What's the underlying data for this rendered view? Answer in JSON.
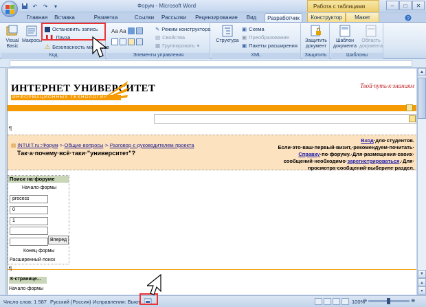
{
  "window": {
    "title": "Форум - Microsoft Word",
    "context_group": "Работа с таблицами"
  },
  "tabs": [
    {
      "label": "Главная"
    },
    {
      "label": "Вставка"
    },
    {
      "label": "Разметка страницы"
    },
    {
      "label": "Ссылки"
    },
    {
      "label": "Рассылки"
    },
    {
      "label": "Рецензирование"
    },
    {
      "label": "Вид"
    },
    {
      "label": "Разработчик"
    },
    {
      "label": "Конструктор"
    },
    {
      "label": "Макет"
    }
  ],
  "ribbon": {
    "code": {
      "label": "Код",
      "visual_basic": "Visual Basic",
      "macros": "Макросы",
      "stop_recording": "Остановить запись",
      "pause": "Пауза",
      "macro_security": "Безопасность макросов"
    },
    "controls": {
      "label": "Элементы управления",
      "design_mode": "Режим конструктора",
      "properties": "Свойства",
      "group": "Группировать"
    },
    "xml": {
      "label": "XML",
      "structure": "Структура",
      "schema": "Схема",
      "transform": "Преобразование",
      "expansion_packs": "Пакеты расширения"
    },
    "protect": {
      "label": "Защитить",
      "protect_document": "Защитить документ"
    },
    "templates": {
      "label": "Шаблоны",
      "document_template": "Шаблон документа",
      "document_panel": "Область документа"
    }
  },
  "document": {
    "logo_big": "ИНТЕРНЕТ УНИВЕРСИТЕТ",
    "logo_small": "ИНФОРМАЦИОННЫХ ТЕХНОЛОГИЙ",
    "slogan": "Твой·путь·к·знаниям",
    "pilcrow": "¶",
    "breadcrumb": {
      "site": "INTUIT.ru::Форум",
      "sep": "·>·",
      "general": "Общие·вопросы",
      "topic": "Разговор·с·руководителем·проекта"
    },
    "topic_title": "Так·а·почему·всё·таки·\"университет\"?",
    "right_info": {
      "login": "Вход",
      "line1_tail": "·для·студентов.",
      "line2": "Если·это·ваш·первый·визит,·рекомендуем·почитать·",
      "help": "Справку",
      "line3_tail": "·по·форуму.·Для·размещения·своих·",
      "line4_head": "сообщений·необходимо·",
      "register": "зарегистрироваться",
      "line4_tail": ".·Для·",
      "line5": "просмотра·сообщений·выберите·раздел."
    },
    "form": {
      "head": "Поиск·на·форуме",
      "start": "Начало·формы",
      "field1": "process",
      "field2": "0",
      "field3": "1",
      "go": "Вперед",
      "end": "Конец·формы",
      "advanced": "Расширенный·поиск"
    },
    "bottom": {
      "k_head": "К·странице...",
      "start": "Начало·формы"
    }
  },
  "status": {
    "words": "Число слов: 1 587",
    "language": "Русский (Россия)",
    "track": "Исправления: Выкл.",
    "zoom": "100%"
  }
}
